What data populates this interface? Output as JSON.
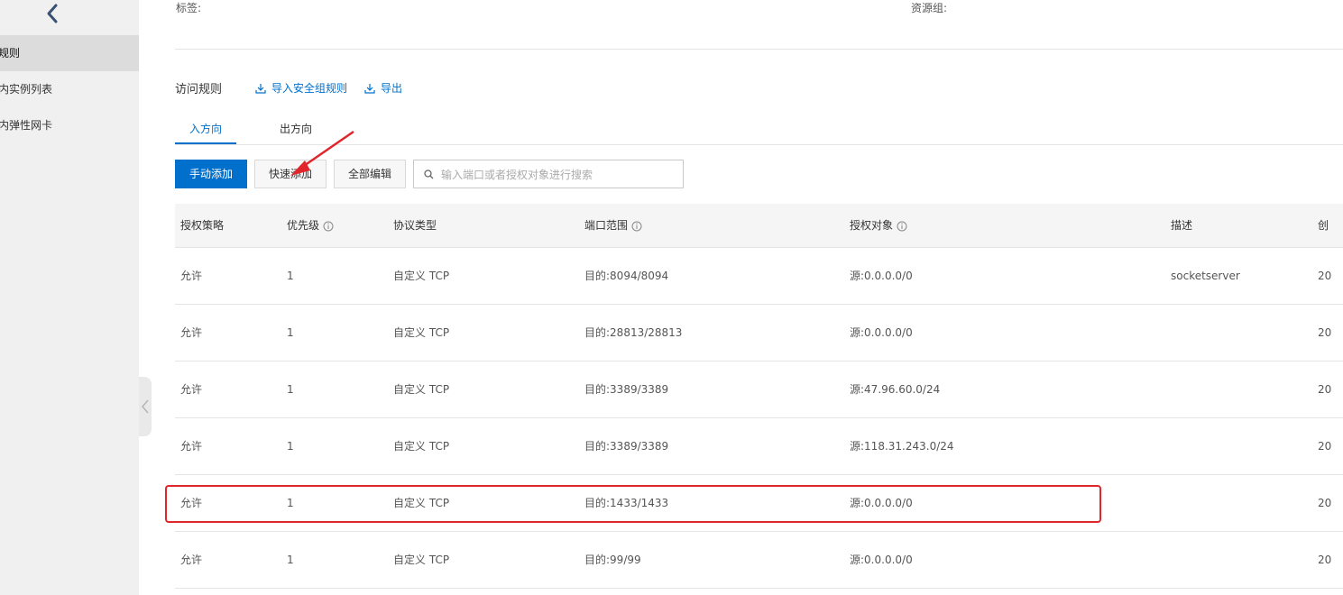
{
  "sidebar": {
    "items": [
      {
        "label": "规则"
      },
      {
        "label": "内实例列表"
      },
      {
        "label": "内弹性网卡"
      }
    ]
  },
  "meta": {
    "tags_label": "标签:",
    "resource_group_label": "资源组:"
  },
  "rules": {
    "title": "访问规则",
    "import_label": "导入安全组规则",
    "export_label": "导出",
    "tabs": [
      {
        "label": "入方向"
      },
      {
        "label": "出方向"
      }
    ],
    "buttons": {
      "manual_add": "手动添加",
      "quick_add": "快速添加",
      "edit_all": "全部编辑"
    },
    "search": {
      "placeholder": "输入端口或者授权对象进行搜索"
    },
    "columns": [
      "授权策略",
      "优先级",
      "协议类型",
      "端口范围",
      "授权对象",
      "描述",
      "创"
    ],
    "rows": [
      {
        "policy": "允许",
        "priority": "1",
        "protocol": "自定义 TCP",
        "port": "目的:8094/8094",
        "source": "源:0.0.0.0/0",
        "desc": "socketserver",
        "created": "20"
      },
      {
        "policy": "允许",
        "priority": "1",
        "protocol": "自定义 TCP",
        "port": "目的:28813/28813",
        "source": "源:0.0.0.0/0",
        "desc": "",
        "created": "20"
      },
      {
        "policy": "允许",
        "priority": "1",
        "protocol": "自定义 TCP",
        "port": "目的:3389/3389",
        "source": "源:47.96.60.0/24",
        "desc": "",
        "created": "20"
      },
      {
        "policy": "允许",
        "priority": "1",
        "protocol": "自定义 TCP",
        "port": "目的:3389/3389",
        "source": "源:118.31.243.0/24",
        "desc": "",
        "created": "20"
      },
      {
        "policy": "允许",
        "priority": "1",
        "protocol": "自定义 TCP",
        "port": "目的:1433/1433",
        "source": "源:0.0.0.0/0",
        "desc": "",
        "created": "20"
      },
      {
        "policy": "允许",
        "priority": "1",
        "protocol": "自定义 TCP",
        "port": "目的:99/99",
        "source": "源:0.0.0.0/0",
        "desc": "",
        "created": "20"
      }
    ]
  },
  "colors": {
    "accent": "#0070cc",
    "annotation": "#e0252b"
  }
}
